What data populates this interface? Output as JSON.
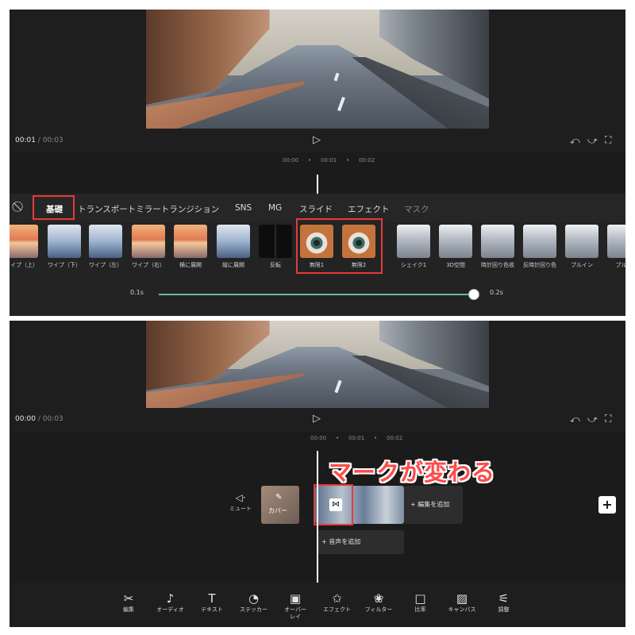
{
  "top": {
    "time_current": "00:01",
    "time_total": "00:03",
    "ruler": [
      "00:00",
      "00:01",
      "00:02"
    ],
    "tabs": [
      "基礎",
      "トランスポートミラートランジション",
      "SNS",
      "MG",
      "スライド",
      "エフェクト",
      "マスク"
    ],
    "thumbnails": [
      {
        "label": "ワイプ（上）",
        "style": "sunset"
      },
      {
        "label": "ワイプ（下）",
        "style": "sea"
      },
      {
        "label": "ワイプ（左）",
        "style": "sea"
      },
      {
        "label": "ワイプ（右）",
        "style": "sunset"
      },
      {
        "label": "横に展開",
        "style": "sunset"
      },
      {
        "label": "縦に展開",
        "style": "sea"
      },
      {
        "label": "反転",
        "style": "dark"
      },
      {
        "label": "無限1",
        "style": "eye"
      },
      {
        "label": "無限2",
        "style": "eye"
      },
      {
        "label": "シェイク1",
        "style": "city"
      },
      {
        "label": "3D空間",
        "style": "city"
      },
      {
        "label": "時計回り色收",
        "style": "city"
      },
      {
        "label": "反時計回り色",
        "style": "city"
      },
      {
        "label": "プルイン",
        "style": "city"
      },
      {
        "label": "プルア",
        "style": "city"
      }
    ],
    "duration_min": "0.1s",
    "duration_max": "0.2s",
    "duration_fraction": 1.0
  },
  "bottom": {
    "time_current": "00:00",
    "time_total": "00:03",
    "ruler": [
      "00:00",
      "00:01",
      "00:02"
    ],
    "annotation": "マークが変わる",
    "mute_label": "ミュート",
    "cover_label": "カバー",
    "add_edit_label": "+ 編集を追加",
    "add_audio_label": "+ 音声を追加",
    "toolbar": [
      {
        "label": "編集",
        "icon": "scissors-icon",
        "glyph": "✂"
      },
      {
        "label": "オーディオ",
        "icon": "music-note-icon",
        "glyph": "♪"
      },
      {
        "label": "テキスト",
        "icon": "text-icon",
        "glyph": "T"
      },
      {
        "label": "ステッカー",
        "icon": "sticker-icon",
        "glyph": "◔"
      },
      {
        "label": "オーバーレイ",
        "icon": "overlay-icon",
        "glyph": "▣"
      },
      {
        "label": "エフェクト",
        "icon": "effect-star-icon",
        "glyph": "✩"
      },
      {
        "label": "フィルター",
        "icon": "filter-icon",
        "glyph": "❀"
      },
      {
        "label": "比率",
        "icon": "ratio-icon",
        "glyph": "□"
      },
      {
        "label": "キャンバス",
        "icon": "canvas-icon",
        "glyph": "▨"
      },
      {
        "label": "調整",
        "icon": "adjust-sliders-icon",
        "glyph": "⚟"
      }
    ]
  },
  "colors": {
    "highlight": "#e63a3a",
    "accent": "#5fb8a8",
    "background": "#1e1e1e"
  }
}
